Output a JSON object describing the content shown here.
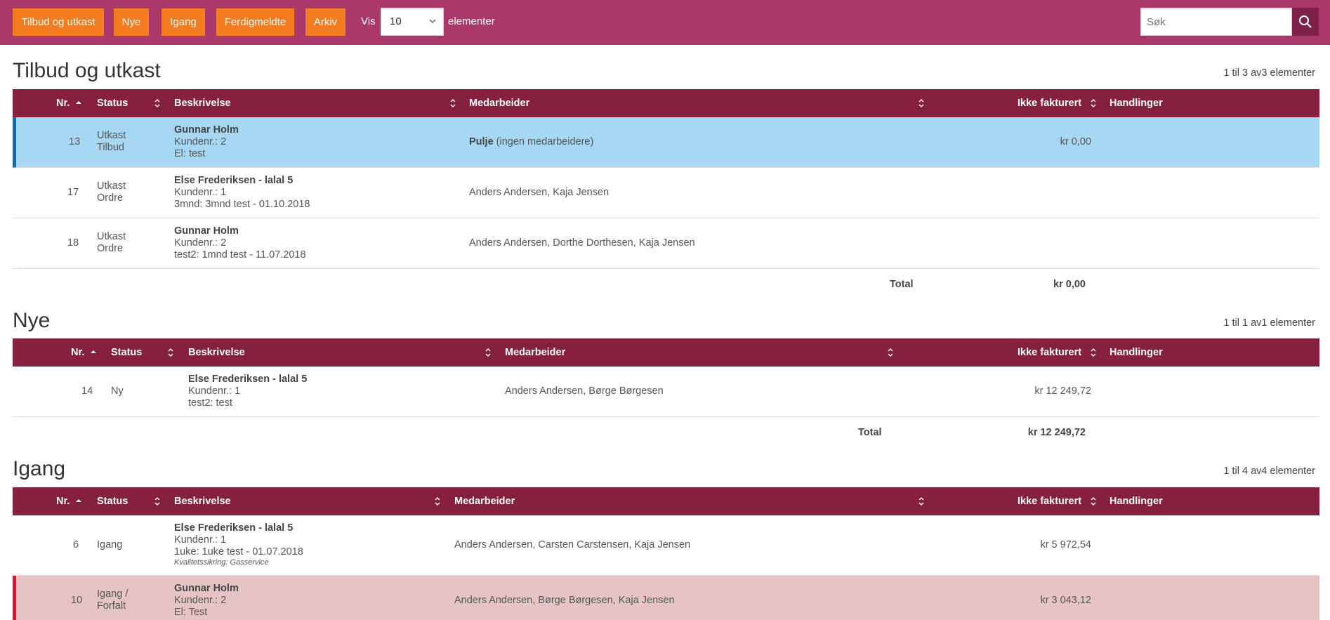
{
  "toolbar": {
    "tabs": [
      "Tilbud og utkast",
      "Nye",
      "Igang",
      "Ferdigmeldte",
      "Arkiv"
    ],
    "vis_label": "Vis",
    "vis_value": "10",
    "elementer_label": "elementer",
    "search_placeholder": "Søk"
  },
  "columns": {
    "nr": "Nr.",
    "status": "Status",
    "beskrivelse": "Beskrivelse",
    "medarbeider": "Medarbeider",
    "ikke_fakturert": "Ikke fakturert",
    "handlinger": "Handlinger"
  },
  "total_label": "Total",
  "sections": [
    {
      "title": "Tilbud og utkast",
      "count": "1 til 3 av3 elementer",
      "rows": [
        {
          "nr": "13",
          "status": [
            "Utkast",
            "Tilbud"
          ],
          "customer": "Gunnar Holm",
          "kundenr": "Kundenr.: 2",
          "desc": "El: test",
          "medarbeider_bold": "Pulje",
          "medarbeider": " (ingen medarbeidere)",
          "amount": "kr 0,00"
        },
        {
          "nr": "17",
          "status": [
            "Utkast",
            "Ordre"
          ],
          "customer": "Else Frederiksen - lalal 5",
          "kundenr": "Kundenr.: 1",
          "desc": "3mnd: 3mnd test - 01.10.2018",
          "medarbeider": "Anders Andersen, Kaja Jensen",
          "amount": ""
        },
        {
          "nr": "18",
          "status": [
            "Utkast",
            "Ordre"
          ],
          "customer": "Gunnar Holm",
          "kundenr": "Kundenr.: 2",
          "desc": "test2: 1mnd test - 11.07.2018",
          "medarbeider": "Anders Andersen, Dorthe Dorthesen, Kaja Jensen",
          "amount": ""
        }
      ],
      "total": "kr 0,00"
    },
    {
      "title": "Nye",
      "count": "1 til 1 av1 elementer",
      "rows": [
        {
          "nr": "14",
          "status": [
            "Ny"
          ],
          "customer": "Else Frederiksen - lalal 5",
          "kundenr": "Kundenr.: 1",
          "desc": "test2: test",
          "medarbeider": "Anders Andersen, Børge Børgesen",
          "amount": "kr 12 249,72"
        }
      ],
      "total": "kr 12 249,72"
    },
    {
      "title": "Igang",
      "count": "1 til 4 av4 elementer",
      "rows": [
        {
          "nr": "6",
          "status": [
            "Igang"
          ],
          "customer": "Else Frederiksen - lalal 5",
          "kundenr": "Kundenr.: 1",
          "desc": "1uke: 1uke test - 01.07.2018",
          "note": "Kvalitetssikring: Gasservice",
          "medarbeider": "Anders Andersen, Carsten Carstensen, Kaja Jensen",
          "amount": "kr 5 972,54"
        },
        {
          "nr": "10",
          "status": [
            "Igang /",
            "Forfalt"
          ],
          "customer": "Gunnar Holm",
          "kundenr": "Kundenr.: 2",
          "desc": "El: Test",
          "medarbeider": "Anders Andersen, Børge Børgesen, Kaja Jensen",
          "amount": "kr 3 043,12"
        }
      ]
    }
  ],
  "colors": {
    "topbar": "#ab386a",
    "tab_button": "#f47c20",
    "table_header": "#85203f",
    "selected_row": "#a6d7f3",
    "overdue_row": "#e6c4c5"
  }
}
